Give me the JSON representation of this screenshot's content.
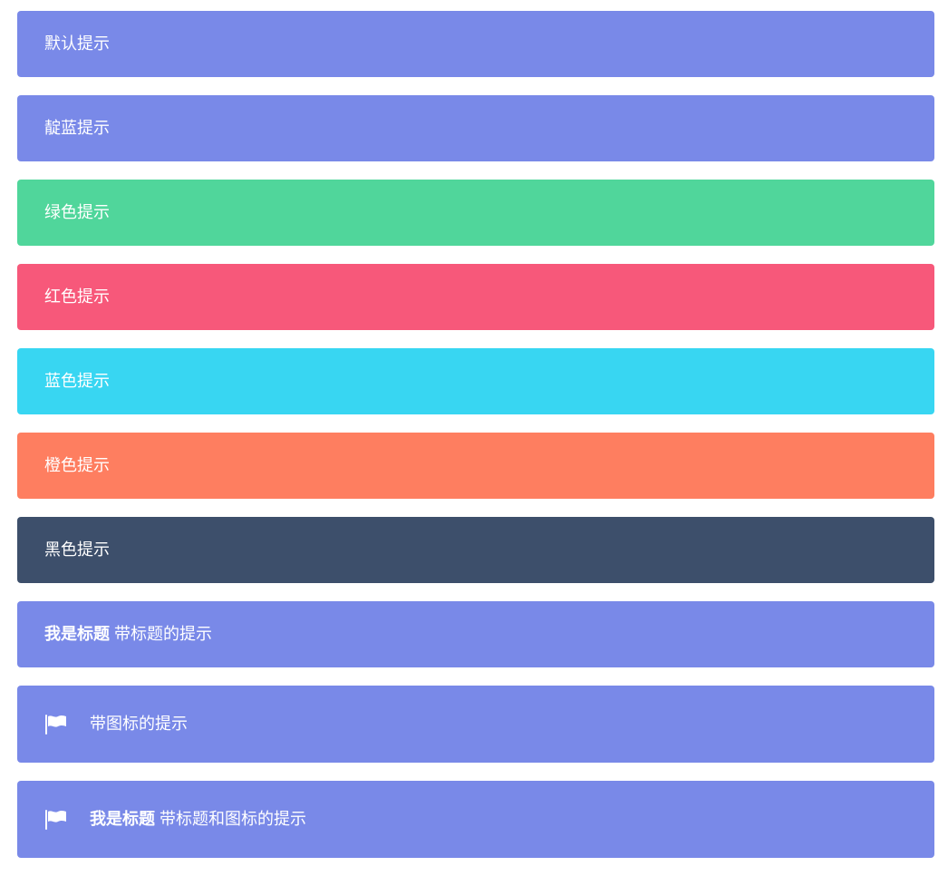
{
  "alerts": [
    {
      "text": "默认提示",
      "color": "#7989e8"
    },
    {
      "text": "靛蓝提示",
      "color": "#7989e8"
    },
    {
      "text": "绿色提示",
      "color": "#50d69b"
    },
    {
      "text": "红色提示",
      "color": "#f7587a"
    },
    {
      "text": "蓝色提示",
      "color": "#38d6f2"
    },
    {
      "text": "橙色提示",
      "color": "#fe7e60"
    },
    {
      "text": "黑色提示",
      "color": "#3d4f6b"
    },
    {
      "title": "我是标题",
      "text": "带标题的提示",
      "color": "#7989e8"
    },
    {
      "icon": "flag-icon",
      "text": "带图标的提示",
      "color": "#7989e8"
    },
    {
      "icon": "flag-icon",
      "title": "我是标题",
      "text": "带标题和图标的提示",
      "color": "#7989e8"
    }
  ]
}
